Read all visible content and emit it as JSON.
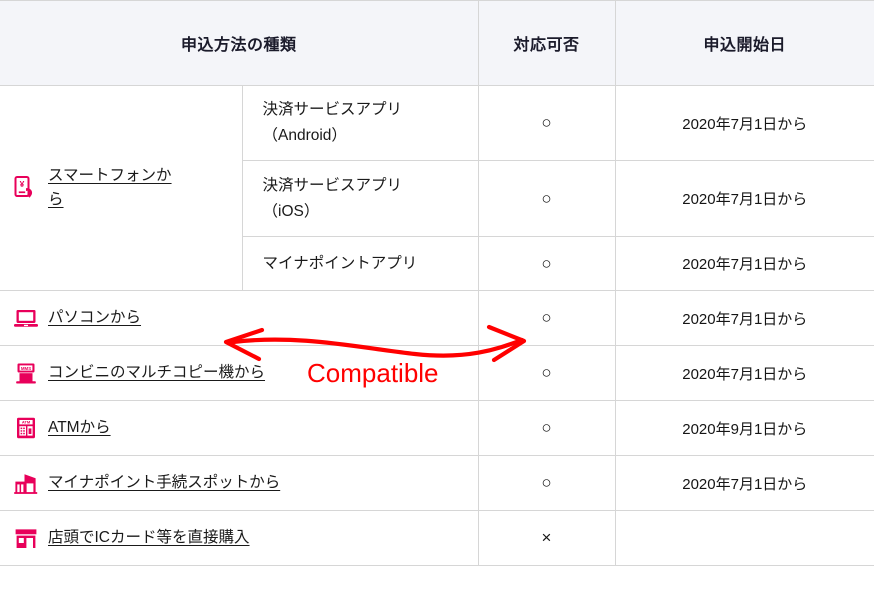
{
  "table": {
    "headers": [
      {
        "label": "申込方法の種類",
        "name": "header-method-type"
      },
      {
        "label": "対応可否",
        "name": "header-availability"
      },
      {
        "label": "申込開始日",
        "name": "header-start-date"
      }
    ],
    "rows": [
      {
        "method": "スマートフォンから",
        "icon": "smartphone-payment-icon",
        "sub": "決済サービスアプリ\n（Android）",
        "sub_line1": "決済サービスアプリ",
        "sub_line2": "（Android）",
        "availability": "○",
        "date": "2020年7月1日から"
      },
      {
        "sub_line1": "決済サービスアプリ",
        "sub_line2": "（iOS）",
        "availability": "○",
        "date": "2020年7月1日から"
      },
      {
        "sub_line1": "マイナポイントアプリ",
        "sub_line2": "",
        "availability": "○",
        "date": "2020年7月1日から"
      },
      {
        "method": "パソコンから",
        "icon": "laptop-icon",
        "availability": "○",
        "date": "2020年7月1日から"
      },
      {
        "method": "コンビニのマルチコピー機から",
        "icon": "multicopy-machine-icon",
        "availability": "○",
        "date": "2020年7月1日から"
      },
      {
        "method": "ATMから",
        "icon": "atm-icon",
        "availability": "○",
        "date": "2020年9月1日から"
      },
      {
        "method": "マイナポイント手続スポットから",
        "icon": "service-spot-icon",
        "availability": "○",
        "date": "2020年7月1日から"
      },
      {
        "method": "店頭でICカード等を直接購入",
        "icon": "storefront-icon",
        "availability": "×",
        "date": ""
      }
    ]
  },
  "annotation": {
    "label": "Compatible",
    "color": "#ff0000",
    "shape": "double-headed-wavy-arrow"
  },
  "colors": {
    "header_background": "#f4f5f9",
    "border": "#d6d6d6",
    "icon_accent": "#e8005a",
    "annotation_red": "#ff0000",
    "text": "#1a1a1a"
  }
}
